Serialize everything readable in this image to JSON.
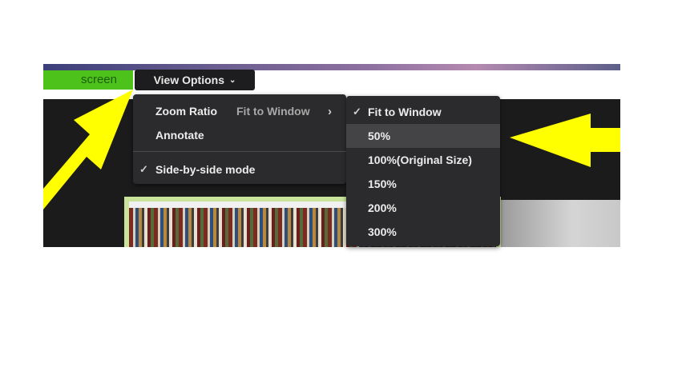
{
  "toolbar": {
    "share_label": "screen",
    "view_options_label": "View Options"
  },
  "menu": {
    "zoom_ratio_label": "Zoom Ratio",
    "zoom_ratio_value": "Fit to Window",
    "annotate_label": "Annotate",
    "side_by_side_label": "Side-by-side mode",
    "side_by_side_checked": true
  },
  "zoom_submenu": {
    "items": [
      {
        "label": "Fit to Window",
        "checked": true
      },
      {
        "label": "50%",
        "hovered": true
      },
      {
        "label": "100%(Original Size)"
      },
      {
        "label": "150%"
      },
      {
        "label": "200%"
      },
      {
        "label": "300%"
      }
    ]
  },
  "colors": {
    "share_green": "#4cc21a",
    "menu_bg": "#2b2b2d",
    "annotation_arrow": "#ffff00"
  }
}
